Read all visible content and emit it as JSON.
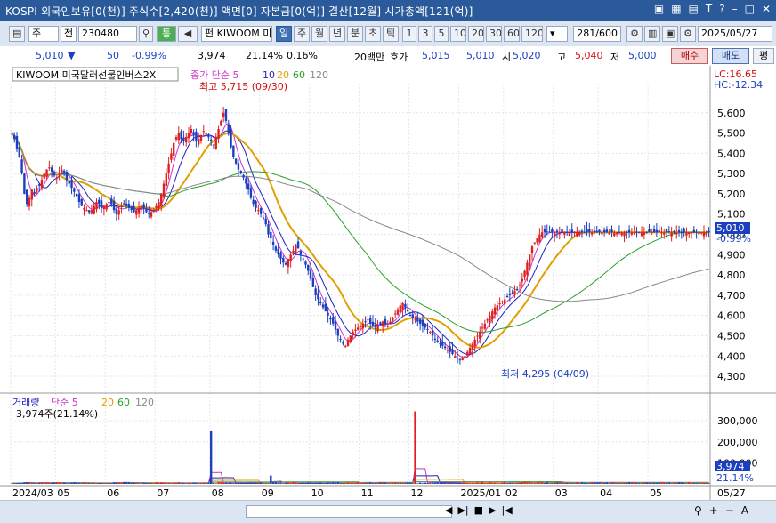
{
  "window": {
    "title": "KOSPI 외국인보유[0(천)] 주식수[2,420(천)] 액면[0] 자본금[0(억)] 결산[12월] 시가총액[121(억)]",
    "icons": [
      "window-icon",
      "grid-icon",
      "chart-icon",
      "font-icon",
      "help-icon",
      "minimize-icon",
      "maximize-icon",
      "close-icon"
    ],
    "icon_glyphs": [
      "▣",
      "▦",
      "▤",
      "T",
      "?",
      "–",
      "□",
      "✕"
    ]
  },
  "toolbar": {
    "market": "주",
    "prev": "전",
    "code": "230480",
    "tong": "통",
    "fund_prefix": "펀",
    "name": "KIWOOM 미국",
    "periods": [
      "일",
      "주",
      "월",
      "년",
      "분",
      "초",
      "틱"
    ],
    "active_period": "일",
    "nums": [
      "1",
      "3",
      "5",
      "10",
      "20",
      "30",
      "60",
      "120"
    ],
    "count": "281",
    "count_total": "/600",
    "date": "2025/05/27"
  },
  "quote": {
    "price": "5,010",
    "arrow": "▼",
    "change": "50",
    "change_pct": "-0.99%",
    "volume": "3,974",
    "vol_ratio": "21.14%",
    "turnover": "0.16%",
    "unit": "20백만",
    "ask_label": "호가",
    "ask_price": "5,015",
    "bid_price": "5,010",
    "open_label": "시",
    "open": "5,020",
    "high_label": "고",
    "high": "5,040",
    "low_label": "저",
    "low": "5,000",
    "buy_button": "매수",
    "sell_button": "매도",
    "eval_button": "평"
  },
  "chart_data": {
    "type": "candlestick",
    "title": "KIWOOM 미국달러선물인버스2X",
    "legend_price": [
      "종가 단순 5",
      "10",
      "20",
      "60",
      "120"
    ],
    "legend_price_colors": [
      "#cc33cc",
      "#2020c0",
      "#e0a000",
      "#2aa02a",
      "#888888"
    ],
    "legend_volume": [
      "거래량",
      "단순 5",
      "20",
      "60",
      "120"
    ],
    "vol_value_label": "3,974주(21.14%)",
    "lc_label": "LC:16.65",
    "hc_label": "HC:-12.34",
    "high_annotation": "최고 5,715 (09/30)",
    "low_annotation": "최저 4,295 (04/09)",
    "last_price_label": "5,010",
    "last_pct_label": "-0.99%",
    "last_volume_label": "3,974",
    "last_vol_pct_label": "21.14%",
    "y_ticks": [
      "5,600",
      "5,500",
      "5,400",
      "5,300",
      "5,200",
      "5,100",
      "5,000",
      "4,900",
      "4,800",
      "4,700",
      "4,600",
      "4,500",
      "4,400",
      "4,300"
    ],
    "y_tick_values": [
      5600,
      5500,
      5400,
      5300,
      5200,
      5100,
      5000,
      4900,
      4800,
      4700,
      4600,
      4500,
      4400,
      4300
    ],
    "ylim": [
      4230,
      5700
    ],
    "vol_ticks": [
      "300,000",
      "200,000",
      "100,000"
    ],
    "vol_tick_values": [
      300000,
      200000,
      100000
    ],
    "vol_ylim": [
      0,
      360000
    ],
    "x_ticks": [
      "2024/03",
      "05",
      "06",
      "07",
      "08",
      "09",
      "10",
      "11",
      "12",
      "2025/01",
      "02",
      "03",
      "04",
      "05",
      "05/27"
    ],
    "x_tick_idx": [
      0,
      18,
      38,
      58,
      80,
      100,
      120,
      140,
      160,
      180,
      198,
      218,
      236,
      256,
      280
    ],
    "candle_count": 281,
    "closes": [
      5500,
      5470,
      5420,
      5380,
      5300,
      5200,
      5150,
      5180,
      5220,
      5200,
      5230,
      5240,
      5270,
      5300,
      5320,
      5330,
      5310,
      5290,
      5280,
      5300,
      5320,
      5300,
      5270,
      5250,
      5230,
      5210,
      5190,
      5160,
      5140,
      5130,
      5120,
      5110,
      5120,
      5140,
      5160,
      5150,
      5130,
      5140,
      5150,
      5160,
      5150,
      5120,
      5100,
      5120,
      5140,
      5150,
      5140,
      5130,
      5120,
      5110,
      5120,
      5130,
      5140,
      5130,
      5110,
      5100,
      5110,
      5120,
      5140,
      5160,
      5200,
      5250,
      5300,
      5350,
      5400,
      5450,
      5480,
      5500,
      5470,
      5460,
      5480,
      5500,
      5520,
      5490,
      5460,
      5470,
      5490,
      5510,
      5500,
      5480,
      5460,
      5440,
      5480,
      5520,
      5560,
      5600,
      5560,
      5500,
      5430,
      5380,
      5350,
      5320,
      5300,
      5280,
      5250,
      5220,
      5180,
      5150,
      5130,
      5120,
      5100,
      5080,
      5050,
      5000,
      4980,
      4950,
      4920,
      4900,
      4880,
      4860,
      4850,
      4880,
      4900,
      4920,
      4950,
      4930,
      4900,
      4880,
      4850,
      4820,
      4780,
      4740,
      4700,
      4680,
      4660,
      4640,
      4620,
      4600,
      4580,
      4560,
      4530,
      4500,
      4480,
      4460,
      4450,
      4480,
      4500,
      4520,
      4530,
      4540,
      4550,
      4560,
      4570,
      4580,
      4560,
      4550,
      4540,
      4550,
      4560,
      4570,
      4560,
      4550,
      4570,
      4590,
      4610,
      4630,
      4650,
      4660,
      4640,
      4620,
      4600,
      4590,
      4580,
      4570,
      4560,
      4550,
      4540,
      4530,
      4520,
      4500,
      4480,
      4470,
      4460,
      4450,
      4440,
      4430,
      4420,
      4410,
      4400,
      4390,
      4380,
      4390,
      4400,
      4420,
      4440,
      4460,
      4480,
      4500,
      4520,
      4540,
      4560,
      4580,
      4600,
      4620,
      4640,
      4650,
      4660,
      4670,
      4680,
      4690,
      4700,
      4710,
      4720,
      4730,
      4750,
      4780,
      4820,
      4860,
      4900,
      4940,
      4960,
      4980,
      5000,
      5010
    ],
    "volumes": []
  },
  "statusbar": {
    "buttons": [
      "◀",
      "▶|",
      "■",
      "▶",
      "|◀",
      "⚲",
      "+",
      "−",
      "A"
    ]
  }
}
